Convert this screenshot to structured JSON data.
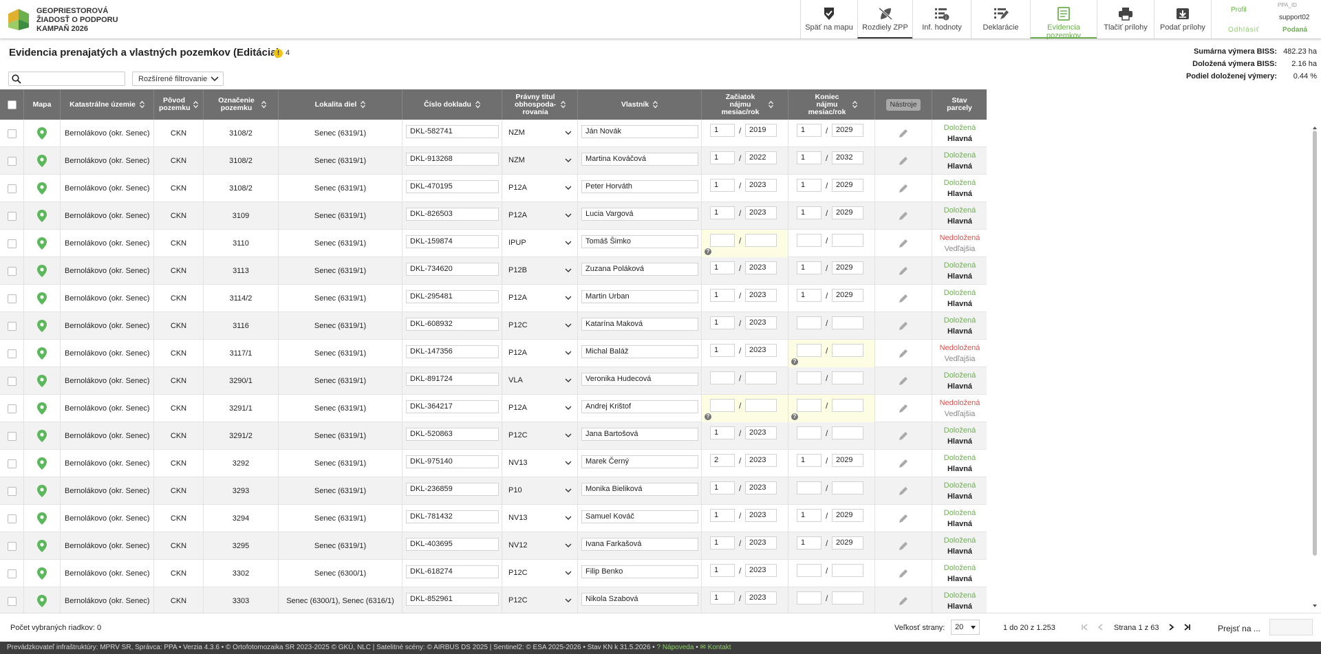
{
  "app": {
    "title_line1": "GEOPRIESTOROVÁ",
    "title_line2": "ŽIADOSŤ O PODPORU",
    "title_line3": "KAMPAŇ 2026"
  },
  "nav": [
    {
      "label": "Späť na mapu",
      "icon": "shield-check-icon"
    },
    {
      "label": "Rozdiely ZPP",
      "icon": "leaf-slash-icon"
    },
    {
      "label": "Inf. hodnoty",
      "icon": "list-info-icon"
    },
    {
      "label": "Deklarácie",
      "icon": "list-edit-icon"
    },
    {
      "label": "Evidencia pozemkov",
      "icon": "document-icon"
    },
    {
      "label": "Tlačiť prílohy",
      "icon": "printer-icon"
    },
    {
      "label": "Podať prílohy",
      "icon": "submit-icon"
    }
  ],
  "profile": {
    "profile_label": "Profil",
    "ppa_id_label": "PPA_ID",
    "user": "support02",
    "logout_label": "Odhlásiť",
    "status": "Podaná"
  },
  "page": {
    "title": "Evidencia prenajatých a vlastných pozemkov (Editácia)",
    "warning_count": "4"
  },
  "stats": [
    {
      "label": "Sumárna výmera BISS:",
      "value": "482.23 ha"
    },
    {
      "label": "Doložená výmera BISS:",
      "value": "2.16 ha"
    },
    {
      "label": "Podiel doloženej výmery:",
      "value": "0.44 %"
    }
  ],
  "search": {
    "placeholder": "",
    "value": ""
  },
  "advanced_filter_label": "Rozšírené filtrovanie",
  "columns": {
    "mapa": "Mapa",
    "kat": "Katastrálne územie",
    "povod": "Pôvod pozemku",
    "oznacenie": "Označenie pozemku",
    "lokalita": "Lokalita diel",
    "cislo": "Číslo dokladu",
    "titul": "Právny titul obhospoda- rovania",
    "vlastnik": "Vlastník",
    "zaciatok": "Začiatok nájmu mesiac/rok",
    "koniec": "Koniec nájmu mesiac/rok",
    "nastroje": "Nástroje",
    "stav": "Stav parcely"
  },
  "rows": [
    {
      "kat": "Bernolákovo (okr. Senec)",
      "povod": "CKN",
      "oz": "3108/2",
      "lok": "Senec (6319/1)",
      "doc": "DKL-582741",
      "titul": "NZM",
      "vl": "Ján Novák",
      "zm": "1",
      "zr": "2019",
      "km": "1",
      "kr": "2029",
      "s1": "Doložená",
      "s2": "Hlavná",
      "ok": true,
      "hz": false,
      "hk": false
    },
    {
      "kat": "Bernolákovo (okr. Senec)",
      "povod": "CKN",
      "oz": "3108/2",
      "lok": "Senec (6319/1)",
      "doc": "DKL-913268",
      "titul": "NZM",
      "vl": "Martina Kováčová",
      "zm": "1",
      "zr": "2022",
      "km": "1",
      "kr": "2032",
      "s1": "Doložená",
      "s2": "Hlavná",
      "ok": true,
      "hz": false,
      "hk": false
    },
    {
      "kat": "Bernolákovo (okr. Senec)",
      "povod": "CKN",
      "oz": "3108/2",
      "lok": "Senec (6319/1)",
      "doc": "DKL-470195",
      "titul": "P12A",
      "vl": "Peter Horváth",
      "zm": "1",
      "zr": "2023",
      "km": "1",
      "kr": "2029",
      "s1": "Doložená",
      "s2": "Hlavná",
      "ok": true,
      "hz": false,
      "hk": false
    },
    {
      "kat": "Bernolákovo (okr. Senec)",
      "povod": "CKN",
      "oz": "3109",
      "lok": "Senec (6319/1)",
      "doc": "DKL-826503",
      "titul": "P12A",
      "vl": "Lucia Vargová",
      "zm": "1",
      "zr": "2023",
      "km": "1",
      "kr": "2029",
      "s1": "Doložená",
      "s2": "Hlavná",
      "ok": true,
      "hz": false,
      "hk": false
    },
    {
      "kat": "Bernolákovo (okr. Senec)",
      "povod": "CKN",
      "oz": "3110",
      "lok": "Senec (6319/1)",
      "doc": "DKL-159874",
      "titul": "IPUP",
      "vl": "Tomáš Šimko",
      "zm": "",
      "zr": "",
      "km": "",
      "kr": "",
      "s1": "Nedoložená",
      "s2": "Vedľajšia",
      "ok": false,
      "hz": true,
      "hk": false
    },
    {
      "kat": "Bernolákovo (okr. Senec)",
      "povod": "CKN",
      "oz": "3113",
      "lok": "Senec (6319/1)",
      "doc": "DKL-734620",
      "titul": "P12B",
      "vl": "Zuzana Poláková",
      "zm": "1",
      "zr": "2023",
      "km": "1",
      "kr": "2029",
      "s1": "Doložená",
      "s2": "Hlavná",
      "ok": true,
      "hz": false,
      "hk": false
    },
    {
      "kat": "Bernolákovo (okr. Senec)",
      "povod": "CKN",
      "oz": "3114/2",
      "lok": "Senec (6319/1)",
      "doc": "DKL-295481",
      "titul": "P12A",
      "vl": "Martin Urban",
      "zm": "1",
      "zr": "2023",
      "km": "1",
      "kr": "2029",
      "s1": "Doložená",
      "s2": "Hlavná",
      "ok": true,
      "hz": false,
      "hk": false
    },
    {
      "kat": "Bernolákovo (okr. Senec)",
      "povod": "CKN",
      "oz": "3116",
      "lok": "Senec (6319/1)",
      "doc": "DKL-608932",
      "titul": "P12C",
      "vl": "Katarína Maková",
      "zm": "1",
      "zr": "2023",
      "km": "",
      "kr": "",
      "s1": "Doložená",
      "s2": "Hlavná",
      "ok": true,
      "hz": false,
      "hk": false
    },
    {
      "kat": "Bernolákovo (okr. Senec)",
      "povod": "CKN",
      "oz": "3117/1",
      "lok": "Senec (6319/1)",
      "doc": "DKL-147356",
      "titul": "P12A",
      "vl": "Michal Baláž",
      "zm": "1",
      "zr": "2023",
      "km": "",
      "kr": "",
      "s1": "Nedoložená",
      "s2": "Vedľajšia",
      "ok": false,
      "hz": false,
      "hk": true
    },
    {
      "kat": "Bernolákovo (okr. Senec)",
      "povod": "CKN",
      "oz": "3290/1",
      "lok": "Senec (6319/1)",
      "doc": "DKL-891724",
      "titul": "VLA",
      "vl": "Veronika Hudecová",
      "zm": "",
      "zr": "",
      "km": "",
      "kr": "",
      "s1": "Doložená",
      "s2": "Hlavná",
      "ok": true,
      "hz": false,
      "hk": false
    },
    {
      "kat": "Bernolákovo (okr. Senec)",
      "povod": "CKN",
      "oz": "3291/1",
      "lok": "Senec (6319/1)",
      "doc": "DKL-364217",
      "titul": "P12A",
      "vl": "Andrej Krištof",
      "zm": "",
      "zr": "",
      "km": "",
      "kr": "",
      "s1": "Nedoložená",
      "s2": "Vedľajšia",
      "ok": false,
      "hz": true,
      "hk": true
    },
    {
      "kat": "Bernolákovo (okr. Senec)",
      "povod": "CKN",
      "oz": "3291/2",
      "lok": "Senec (6319/1)",
      "doc": "DKL-520863",
      "titul": "P12C",
      "vl": "Jana Bartošová",
      "zm": "1",
      "zr": "2023",
      "km": "",
      "kr": "",
      "s1": "Doložená",
      "s2": "Hlavná",
      "ok": true,
      "hz": false,
      "hk": false
    },
    {
      "kat": "Bernolákovo (okr. Senec)",
      "povod": "CKN",
      "oz": "3292",
      "lok": "Senec (6319/1)",
      "doc": "DKL-975140",
      "titul": "NV13",
      "vl": "Marek Černý",
      "zm": "2",
      "zr": "2023",
      "km": "1",
      "kr": "2029",
      "s1": "Doložená",
      "s2": "Hlavná",
      "ok": true,
      "hz": false,
      "hk": false
    },
    {
      "kat": "Bernolákovo (okr. Senec)",
      "povod": "CKN",
      "oz": "3293",
      "lok": "Senec (6319/1)",
      "doc": "DKL-236859",
      "titul": "P10",
      "vl": "Monika Bieliková",
      "zm": "1",
      "zr": "2023",
      "km": "",
      "kr": "",
      "s1": "Doložená",
      "s2": "Hlavná",
      "ok": true,
      "hz": false,
      "hk": false
    },
    {
      "kat": "Bernolákovo (okr. Senec)",
      "povod": "CKN",
      "oz": "3294",
      "lok": "Senec (6319/1)",
      "doc": "DKL-781432",
      "titul": "NV13",
      "vl": "Samuel Kováč",
      "zm": "1",
      "zr": "2023",
      "km": "1",
      "kr": "2029",
      "s1": "Doložená",
      "s2": "Hlavná",
      "ok": true,
      "hz": false,
      "hk": false
    },
    {
      "kat": "Bernolákovo (okr. Senec)",
      "povod": "CKN",
      "oz": "3295",
      "lok": "Senec (6319/1)",
      "doc": "DKL-403695",
      "titul": "NV12",
      "vl": "Ivana Farkašová",
      "zm": "1",
      "zr": "2023",
      "km": "1",
      "kr": "2029",
      "s1": "Doložená",
      "s2": "Hlavná",
      "ok": true,
      "hz": false,
      "hk": false
    },
    {
      "kat": "Bernolákovo (okr. Senec)",
      "povod": "CKN",
      "oz": "3302",
      "lok": "Senec (6300/1)",
      "doc": "DKL-618274",
      "titul": "P12C",
      "vl": "Filip Benko",
      "zm": "1",
      "zr": "2023",
      "km": "",
      "kr": "",
      "s1": "Doložená",
      "s2": "Hlavná",
      "ok": true,
      "hz": false,
      "hk": false
    },
    {
      "kat": "Bernolákovo (okr. Senec)",
      "povod": "CKN",
      "oz": "3303",
      "lok": "Senec (6300/1), Senec (6316/1)",
      "doc": "DKL-852961",
      "titul": "P12C",
      "vl": "Nikola Szabová",
      "zm": "1",
      "zr": "2023",
      "km": "",
      "kr": "",
      "s1": "Doložená",
      "s2": "Hlavná",
      "ok": true,
      "hz": false,
      "hk": false
    }
  ],
  "footer": {
    "selected_label": "Počet vybraných riadkov: 0",
    "page_size_label": "Veľkosť strany:",
    "page_size": "20",
    "range": "1 do 20 z 1.253",
    "page_info": "Strana 1 z 63",
    "goto_label": "Prejsť na ..."
  },
  "statusbar": {
    "text": "Prevádzkovateľ infraštruktúry: MPRV SR, Správca: PPA • Verzia 4.3.6 • © Ortofotomozaika SR 2023-2025 © GKÚ, NLC | Satelitné scény: © AIRBUS DS 2025 | Sentinel2: © ESA 2025-2026 • Stav KN k 31.5.2026 •",
    "help": "Nápoveda",
    "contact": "Kontakt"
  },
  "colors": {
    "accent": "#6ab04c",
    "danger": "#d9534f",
    "header_bg": "#6f6f6f"
  }
}
